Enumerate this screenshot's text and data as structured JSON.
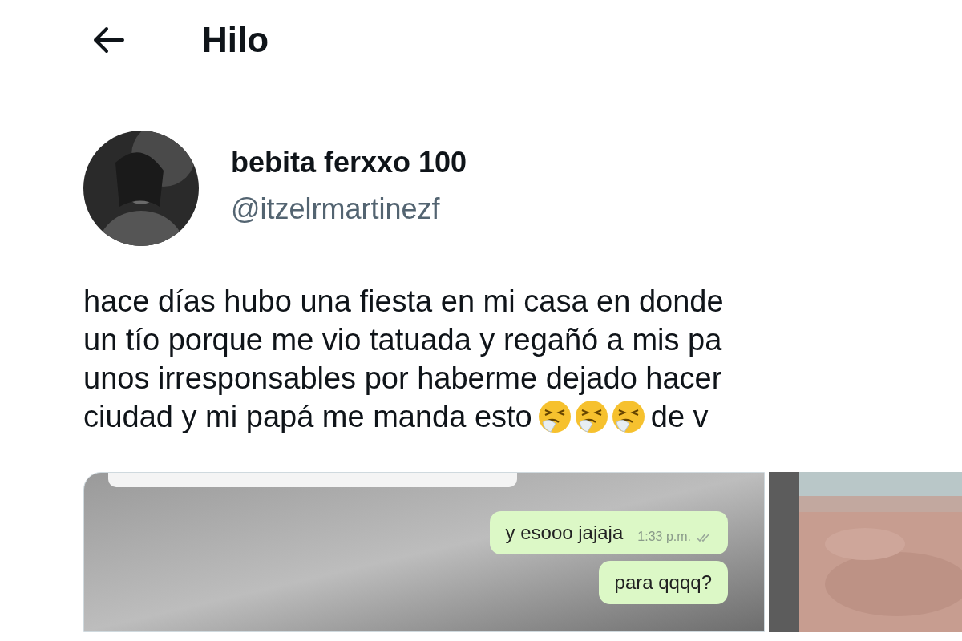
{
  "header": {
    "title": "Hilo"
  },
  "author": {
    "name": "bebita ferxxo 100",
    "handle": "@itzelrmartinezf"
  },
  "tweet_lines": [
    [
      {
        "kind": "text",
        "text": "hace días hubo una fiesta en mi casa en donde"
      }
    ],
    [
      {
        "kind": "text",
        "text": "un tío porque me vio tatuada y regañó a mis pa"
      }
    ],
    [
      {
        "kind": "text",
        "text": "unos irresponsables por haberme dejado hacer"
      }
    ],
    [
      {
        "kind": "text",
        "text": "ciudad y mi papá me manda esto"
      },
      {
        "kind": "emoji"
      },
      {
        "kind": "emoji"
      },
      {
        "kind": "emoji"
      },
      {
        "kind": "text",
        "text": "de v"
      }
    ]
  ],
  "media": [
    {
      "kind": "chat",
      "messages": [
        {
          "text": "y esooo jajaja",
          "time": "1:33 p.m."
        },
        {
          "text": "para qqqq?"
        }
      ]
    },
    {
      "kind": "picture"
    }
  ]
}
